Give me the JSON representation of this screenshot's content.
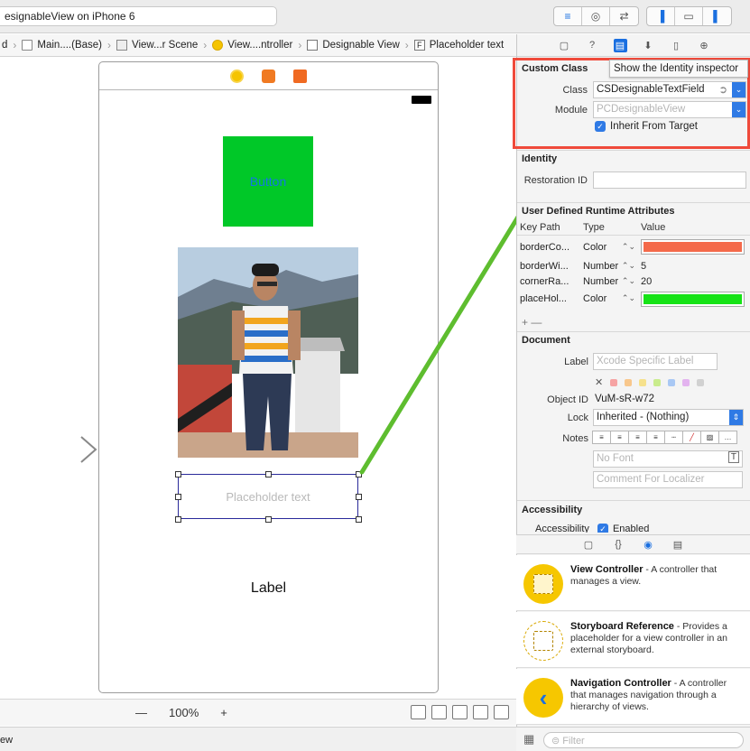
{
  "toolbar": {
    "scheme_text": "esignableView on iPhone 6"
  },
  "breadcrumb": [
    {
      "label": "d"
    },
    {
      "label": "Main....(Base)"
    },
    {
      "label": "View...r Scene"
    },
    {
      "label": "View....ntroller"
    },
    {
      "label": "Designable View"
    },
    {
      "label": "Placeholder text"
    }
  ],
  "canvas": {
    "button_title": "Button",
    "textfield_placeholder": "Placeholder text",
    "label_text": "Label",
    "zoom_level": "100%",
    "zoom_minus": "—",
    "zoom_plus": "+"
  },
  "statusbar": {
    "text": "ew"
  },
  "inspector": {
    "custom_class_title": "Custom Class",
    "tooltip": "Show the Identity inspector",
    "class_label": "Class",
    "class_value": "CSDesignableTextField",
    "module_label": "Module",
    "module_placeholder": "PCDesignableView",
    "inherit_label": "Inherit From Target",
    "identity_title": "Identity",
    "restoration_label": "Restoration ID",
    "udra_title": "User Defined Runtime Attributes",
    "col_keypath": "Key Path",
    "col_type": "Type",
    "col_value": "Value",
    "attributes": [
      {
        "key": "borderCo...",
        "type": "Color",
        "value": "",
        "color": "#f4694a"
      },
      {
        "key": "borderWi...",
        "type": "Number",
        "value": "5",
        "color": ""
      },
      {
        "key": "cornerRa...",
        "type": "Number",
        "value": "20",
        "color": ""
      },
      {
        "key": "placeHol...",
        "type": "Color",
        "value": "",
        "color": "#16e316"
      }
    ],
    "add_remove": "+  —",
    "document_title": "Document",
    "doc_label": "Label",
    "doc_label_placeholder": "Xcode Specific Label",
    "object_id_label": "Object ID",
    "object_id_value": "VuM-sR-w72",
    "lock_label": "Lock",
    "lock_value": "Inherited - (Nothing)",
    "notes_label": "Notes",
    "no_font_placeholder": "No Font",
    "localizer_placeholder": "Comment For Localizer",
    "accessibility_title": "Accessibility",
    "accessibility_row": "Accessibility",
    "accessibility_enabled": "Enabled"
  },
  "library": {
    "items": [
      {
        "title": "View Controller",
        "desc": " - A controller that manages a view."
      },
      {
        "title": "Storyboard Reference",
        "desc": " - Provides a placeholder for a view controller in an external storyboard."
      },
      {
        "title": "Navigation Controller",
        "desc": " - A controller that manages navigation through a hierarchy of views."
      }
    ],
    "filter_placeholder": "Filter"
  },
  "colors": {
    "accent": "#1a6fe0",
    "annotation_red": "#ef4a3b",
    "annotation_green": "#5ebd2f",
    "button_green": "#00c828"
  }
}
